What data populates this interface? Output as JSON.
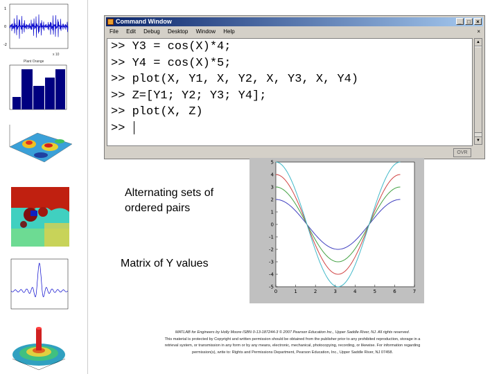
{
  "command_window": {
    "title": "Command Window",
    "menu": [
      "File",
      "Edit",
      "Debug",
      "Desktop",
      "Window",
      "Help"
    ],
    "menu_right": "×",
    "lines": [
      ">> Y3 = cos(X)*4;",
      ">> Y4 = cos(X)*5;",
      ">> plot(X, Y1, X, Y2, X, Y3, X, Y4)",
      ">> Z=[Y1; Y2; Y3; Y4];",
      ">> plot(X, Z)",
      ">> "
    ],
    "status": "OVR",
    "buttons": {
      "minimize": "_",
      "maximize": "□",
      "close": "×"
    }
  },
  "captions": {
    "pairs": "Alternating sets of ordered pairs",
    "matrix": "Matrix of Y values"
  },
  "footer": {
    "line1": "MATLAB for Engineers by Holly Moore ISBN 0-13-187244-3 © 2007 Pearson Education Inc., Upper Saddle River, NJ. All rights reserved.",
    "line2": "This material is protected by Copyright and written permission should be obtained from the publisher prior to any prohibited reproduction, storage in a",
    "line3": "retrieval system, or transmission in any form or by any means, electronic, mechanical, photocopying, recording, or likewise. For information regarding",
    "line4": "permission(s), write to: Rights and Permissions Department, Pearson Education, Inc., Upper Saddle River, NJ 07458."
  },
  "sidebar_labels": {
    "signal_xtick": "x 10",
    "hist_title": "Plant Orange"
  },
  "chart_data": {
    "type": "line",
    "x_function": "x from 0 to 2π",
    "xlim": [
      0,
      7
    ],
    "ylim": [
      -5,
      5
    ],
    "xticks": [
      "0",
      "1",
      "2",
      "3",
      "4",
      "5",
      "6",
      "7"
    ],
    "yticks": [
      "5",
      "4",
      "3",
      "2",
      "1",
      "0",
      "-1",
      "-2",
      "-3",
      "-4",
      "-5"
    ],
    "grid": false,
    "series": [
      {
        "amplitude": 2,
        "color": "#4040c0"
      },
      {
        "amplitude": 3,
        "color": "#40a040"
      },
      {
        "amplitude": 4,
        "color": "#d04040"
      },
      {
        "amplitude": 5,
        "color": "#40b8c8"
      }
    ]
  }
}
